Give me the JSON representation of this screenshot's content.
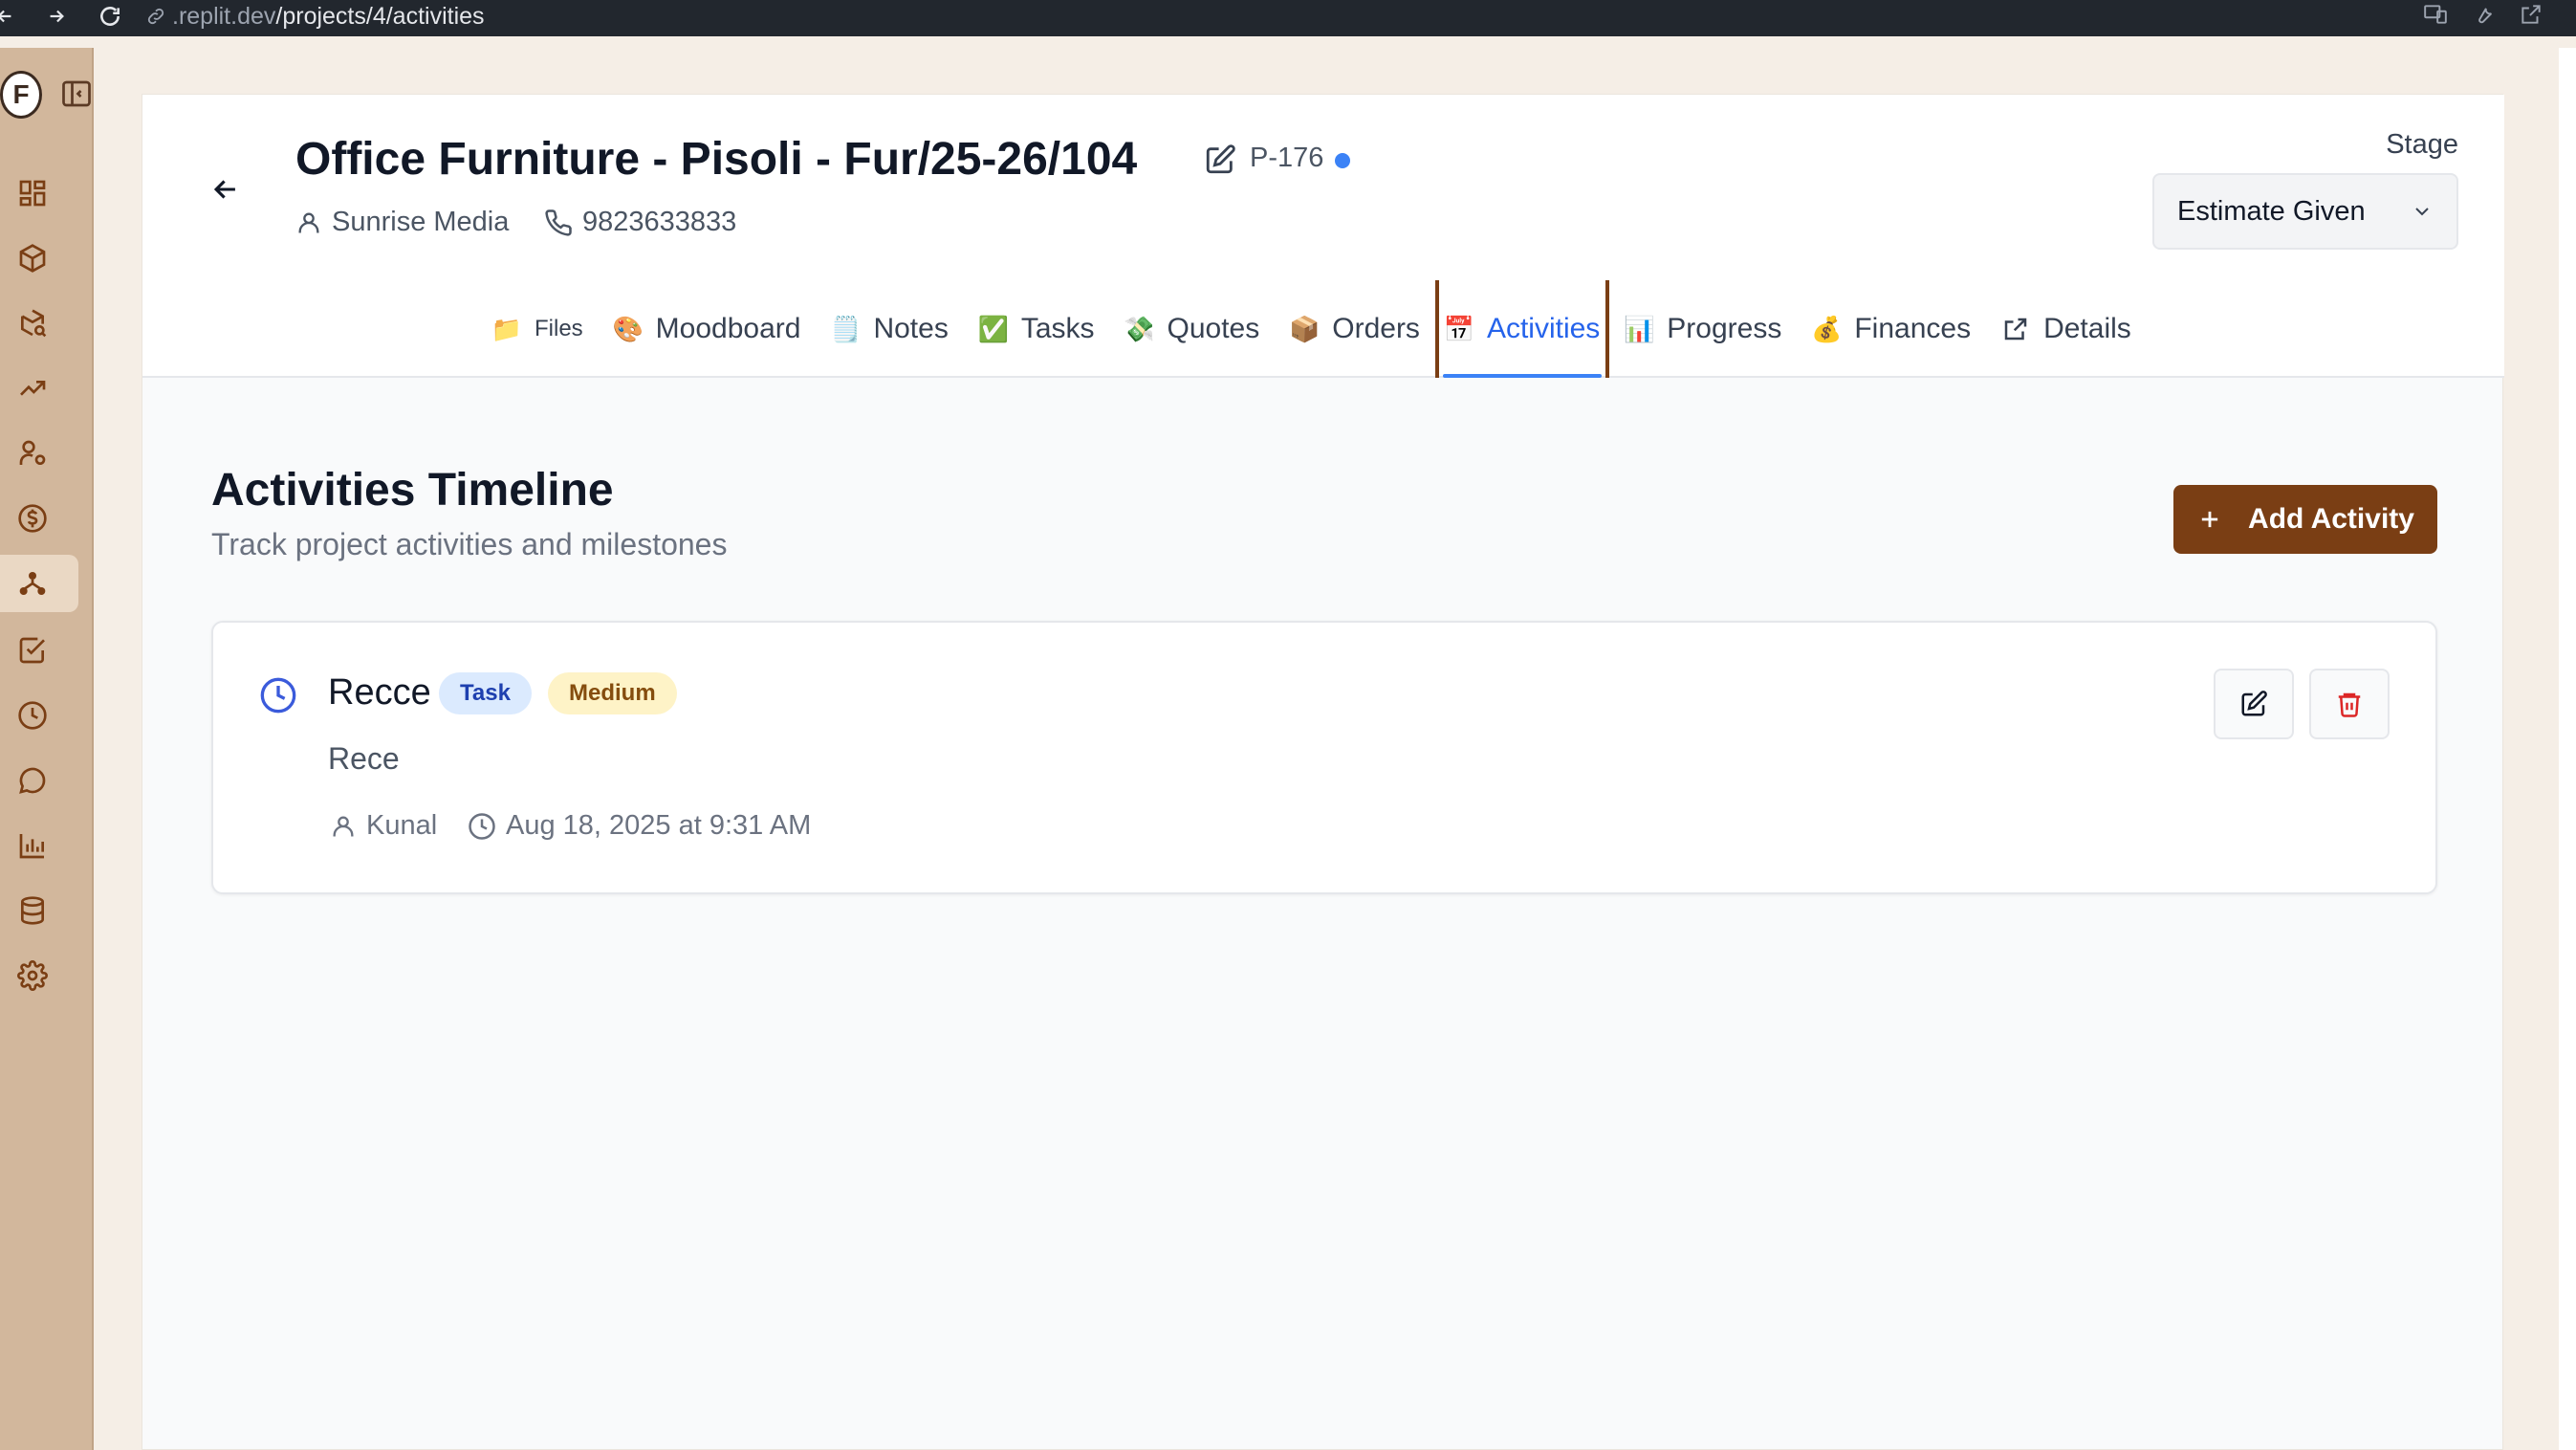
{
  "browser": {
    "url_prefix": ".replit.dev",
    "url_path": "/projects/4/activities"
  },
  "sidebar": {
    "logo_text": "F",
    "items": [
      {
        "icon": "dashboard-icon"
      },
      {
        "icon": "box-icon"
      },
      {
        "icon": "package-search-icon"
      },
      {
        "icon": "trending-up-icon"
      },
      {
        "icon": "user-cog-icon"
      },
      {
        "icon": "dollar-icon"
      },
      {
        "icon": "network-icon",
        "active": true
      },
      {
        "icon": "checkbox-icon"
      },
      {
        "icon": "clock-icon"
      },
      {
        "icon": "chat-icon"
      },
      {
        "icon": "bar-chart-icon"
      },
      {
        "icon": "database-icon"
      },
      {
        "icon": "gear-icon"
      }
    ]
  },
  "project": {
    "title": "Office Furniture - Pisoli - Fur/25-26/104",
    "code": "P-176",
    "client": "Sunrise Media",
    "phone": "9823633833",
    "stage_label": "Stage",
    "stage_value": "Estimate Given"
  },
  "tabs": [
    {
      "emoji": "📁",
      "label": "Files"
    },
    {
      "emoji": "🎨",
      "label": "Moodboard"
    },
    {
      "emoji": "🗒️",
      "label": "Notes"
    },
    {
      "emoji": "✅",
      "label": "Tasks"
    },
    {
      "emoji": "💸",
      "label": "Quotes"
    },
    {
      "emoji": "📦",
      "label": "Orders"
    },
    {
      "emoji": "📅",
      "label": "Activities",
      "active": true
    },
    {
      "emoji": "📊",
      "label": "Progress"
    },
    {
      "emoji": "💰",
      "label": "Finances"
    },
    {
      "emoji": "",
      "label": "Details"
    }
  ],
  "content": {
    "title": "Activities Timeline",
    "subtitle": "Track project activities and milestones",
    "add_button": "Add Activity"
  },
  "activities": [
    {
      "title": "Recce",
      "type": "Task",
      "priority": "Medium",
      "description": "Rece",
      "user": "Kunal",
      "datetime": "Aug 18, 2025 at 9:31 AM"
    }
  ],
  "colors": {
    "brand": "#7a3e14",
    "accent_blue": "#2563eb",
    "sidebar_bg": "#d2b79c"
  }
}
